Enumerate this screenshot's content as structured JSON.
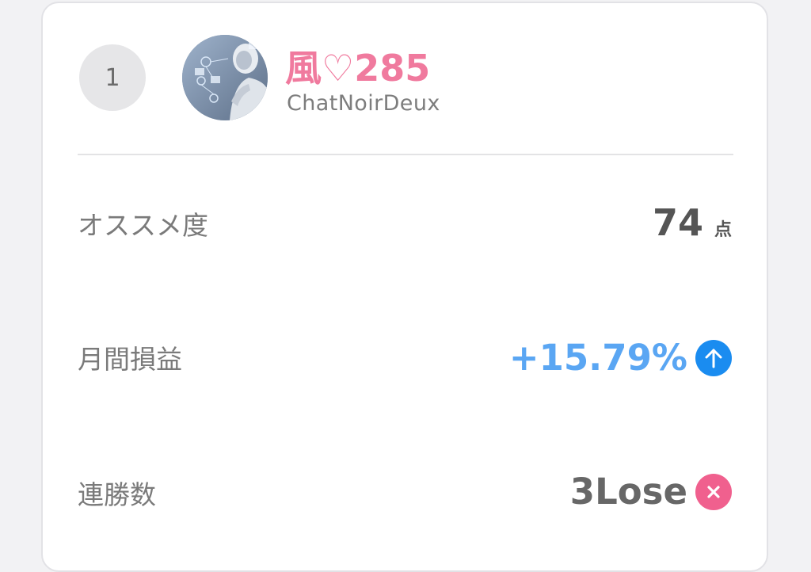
{
  "entry": {
    "rank": "1",
    "name": "風♡285",
    "handle": "ChatNoirDeux"
  },
  "stats": {
    "recommend": {
      "label": "オススメ度",
      "value": "74",
      "unit": "点"
    },
    "monthly_pl": {
      "label": "月間損益",
      "value": "+15.79%",
      "icon": "arrow-up-icon"
    },
    "streak": {
      "label": "連勝数",
      "value": "3Lose",
      "icon": "close-x-icon"
    }
  },
  "colors": {
    "name": "#f07a9e",
    "profit": "#5aa6f3",
    "up_icon": "#1a8cf0",
    "lose_icon": "#f0608e"
  }
}
